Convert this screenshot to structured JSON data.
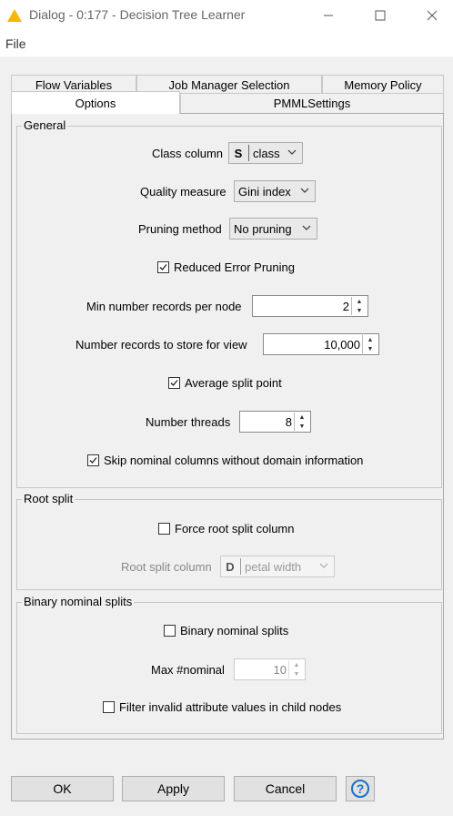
{
  "window": {
    "title": "Dialog - 0:177 - Decision Tree Learner"
  },
  "menu": {
    "file": "File"
  },
  "tabs": {
    "flow_variables": "Flow Variables",
    "job_manager": "Job Manager Selection",
    "memory_policy": "Memory Policy",
    "options": "Options",
    "pmml": "PMMLSettings"
  },
  "general": {
    "title": "General",
    "class_column_label": "Class column",
    "class_column_type": "S",
    "class_column_value": "class",
    "quality_label": "Quality measure",
    "quality_value": "Gini index",
    "pruning_label": "Pruning method",
    "pruning_value": "No pruning",
    "reduced_error_label": "Reduced Error Pruning",
    "reduced_error_checked": true,
    "min_records_label": "Min number records per node",
    "min_records_value": "2",
    "records_view_label": "Number records to store for view",
    "records_view_value": "10,000",
    "avg_split_label": "Average split point",
    "avg_split_checked": true,
    "threads_label": "Number threads",
    "threads_value": "8",
    "skip_nominal_label": "Skip nominal columns without domain information",
    "skip_nominal_checked": true
  },
  "root_split": {
    "title": "Root split",
    "force_label": "Force root split column",
    "force_checked": false,
    "column_label": "Root split column",
    "column_type": "D",
    "column_value": "petal width"
  },
  "binary": {
    "title": "Binary nominal splits",
    "binary_label": "Binary nominal splits",
    "binary_checked": false,
    "max_nominal_label": "Max #nominal",
    "max_nominal_value": "10",
    "filter_label": "Filter invalid attribute values in child nodes",
    "filter_checked": false
  },
  "buttons": {
    "ok": "OK",
    "apply": "Apply",
    "cancel": "Cancel",
    "help": "?"
  },
  "colors": {
    "knime_logo": "#f5b800",
    "help_blue": "#1e6fc8",
    "panel_bg": "#f0f0f0"
  },
  "icons": [
    "knime-triangle-icon",
    "minimize-icon",
    "maximize-icon",
    "close-icon",
    "chevron-down-icon",
    "checkmark-icon",
    "spinner-up-icon",
    "spinner-down-icon",
    "help-icon"
  ]
}
